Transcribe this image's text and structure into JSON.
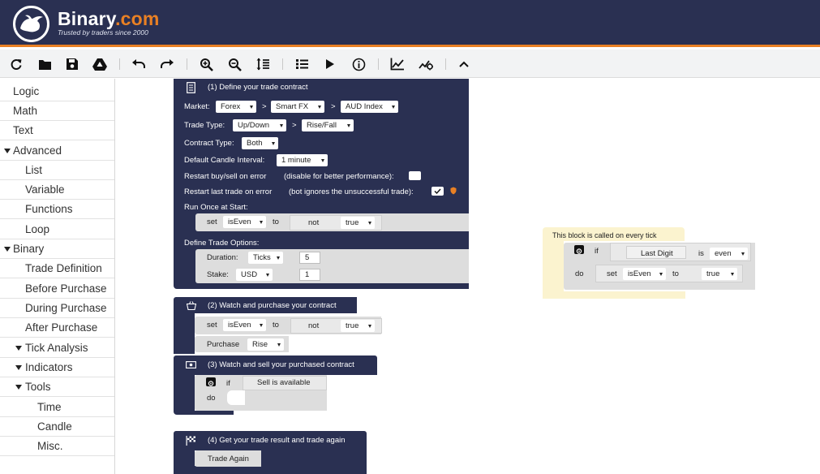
{
  "header": {
    "brand_name": "Binary",
    "brand_suffix": ".com",
    "tagline": "Trusted by traders since 2000",
    "colors": {
      "navy": "#2a3052",
      "orange": "#e98024"
    }
  },
  "toolbar": {
    "icons": [
      "reset-icon",
      "open-folder-icon",
      "save-icon",
      "google-drive-icon",
      "undo-icon",
      "redo-icon",
      "zoom-in-icon",
      "zoom-out-icon",
      "rearrange-icon",
      "summary-icon",
      "run-icon",
      "info-icon",
      "chart-icon",
      "integrations-icon",
      "collapse-icon"
    ]
  },
  "sidebar": {
    "items": [
      {
        "label": "Logic"
      },
      {
        "label": "Math"
      },
      {
        "label": "Text"
      },
      {
        "label": "Advanced"
      },
      {
        "label": "List"
      },
      {
        "label": "Variable"
      },
      {
        "label": "Functions"
      },
      {
        "label": "Loop"
      },
      {
        "label": "Binary"
      },
      {
        "label": "Trade Definition"
      },
      {
        "label": "Before Purchase"
      },
      {
        "label": "During Purchase"
      },
      {
        "label": "After Purchase"
      },
      {
        "label": "Tick Analysis"
      },
      {
        "label": "Indicators"
      },
      {
        "label": "Tools"
      },
      {
        "label": "Time"
      },
      {
        "label": "Candle"
      },
      {
        "label": "Misc."
      }
    ]
  },
  "trade_block": {
    "title": "(1) Define your trade contract",
    "market_label": "Market:",
    "market": "Forex",
    "submarket": "Smart FX",
    "symbol": "AUD Index",
    "sep": ">",
    "trade_type_label": "Trade Type:",
    "trade_category": "Up/Down",
    "trade_type": "Rise/Fall",
    "contract_type_label": "Contract Type:",
    "contract_type": "Both",
    "candle_label": "Default Candle Interval:",
    "candle_interval": "1 minute",
    "restart_error_label": "Restart buy/sell on error",
    "restart_error_hint": "(disable for better performance):",
    "restart_last_label": "Restart last trade on error",
    "restart_last_hint": "(bot ignores the unsuccessful trade):",
    "run_once_label": "Run Once at Start:",
    "set_label": "set",
    "var_name": "isEven",
    "to_label": "to",
    "not_label": "not",
    "bool_value": "true",
    "options_label": "Define Trade Options:",
    "duration_label": "Duration:",
    "duration_unit": "Ticks",
    "duration_value": "5",
    "stake_label": "Stake:",
    "currency": "USD",
    "stake_value": "1"
  },
  "purchase_block": {
    "title": "(2) Watch and purchase your contract",
    "set_label": "set",
    "var_name": "isEven",
    "to_label": "to",
    "not_label": "not",
    "bool_value": "true",
    "purchase_label": "Purchase",
    "purchase_type": "Rise"
  },
  "sell_block": {
    "title": "(3) Watch and sell your purchased contract",
    "if_label": "if",
    "condition": "Sell is available",
    "do_label": "do"
  },
  "after_block": {
    "title": "(4) Get your trade result and trade again",
    "button_label": "Trade Again"
  },
  "tick_block": {
    "title": "This block is called on every tick",
    "if_label": "if",
    "last_digit": "Last Digit",
    "is_label": "is",
    "parity": "even",
    "do_label": "do",
    "set_label": "set",
    "var_name": "isEven",
    "to_label": "to",
    "bool_value": "true"
  }
}
